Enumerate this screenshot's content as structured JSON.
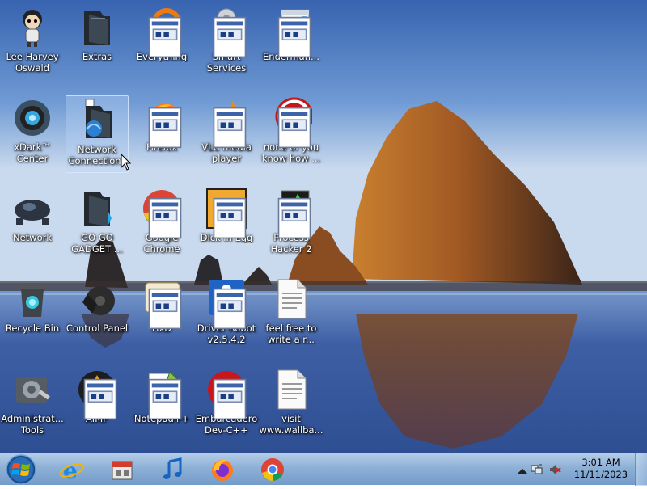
{
  "desktop": {
    "icons": [
      {
        "label": "Lee Harvey Oswald",
        "icon": "cartoon-person-icon"
      },
      {
        "label": "Extras",
        "icon": "folder-dark-icon"
      },
      {
        "label": "Everything",
        "icon": "everything-search-icon"
      },
      {
        "label": "Smart Services",
        "icon": "gear-settings-icon"
      },
      {
        "label": "Enderman...",
        "icon": "window-icon"
      },
      {
        "label": "xDark™ Center",
        "icon": "xdark-icon"
      },
      {
        "label": "Network Connections",
        "icon": "network-folder-icon"
      },
      {
        "label": "Firefox",
        "icon": "firefox-icon"
      },
      {
        "label": "VLC media player",
        "icon": "vlc-cone-icon"
      },
      {
        "label": "none of you know how ...",
        "icon": "red-swirl-icon"
      },
      {
        "label": "Network",
        "icon": "network-dark-icon"
      },
      {
        "label": "GO GO GADGET ...",
        "icon": "folder-dark-icon"
      },
      {
        "label": "Google Chrome",
        "icon": "chrome-icon"
      },
      {
        "label": "Dick in Egg",
        "icon": "dick-in-egg-icon"
      },
      {
        "label": "Process Hacker 2",
        "icon": "process-hacker-icon"
      },
      {
        "label": "Recycle Bin",
        "icon": "recycle-bin-icon"
      },
      {
        "label": "Control Panel",
        "icon": "control-panel-icon"
      },
      {
        "label": "HxD",
        "icon": "hxd-icon"
      },
      {
        "label": "Driver Robot v2.5.4.2",
        "icon": "driver-robot-icon"
      },
      {
        "label": "feel free to write a r...",
        "icon": "text-document-icon"
      },
      {
        "label": "Administrat... Tools",
        "icon": "admin-tools-icon"
      },
      {
        "label": "AIMP",
        "icon": "aimp-icon"
      },
      {
        "label": "Notepad++",
        "icon": "notepad-plus-icon"
      },
      {
        "label": "Embarcadero Dev-C++",
        "icon": "devcpp-icon"
      },
      {
        "label": "visit www.wallba...",
        "icon": "text-document-icon"
      }
    ]
  },
  "taskbar": {
    "pinned": [
      {
        "name": "internet-explorer-icon"
      },
      {
        "name": "app-store-icon"
      },
      {
        "name": "music-note-icon"
      },
      {
        "name": "firefox-icon"
      },
      {
        "name": "chrome-icon"
      }
    ],
    "tray": {
      "time": "3:01 AM",
      "date": "11/11/2023"
    }
  },
  "colors": {
    "sky_top": "#3f6fb8",
    "sea": "#3b5a9c",
    "rock": "#a45a22",
    "taskbar": "#a9c6e6"
  }
}
